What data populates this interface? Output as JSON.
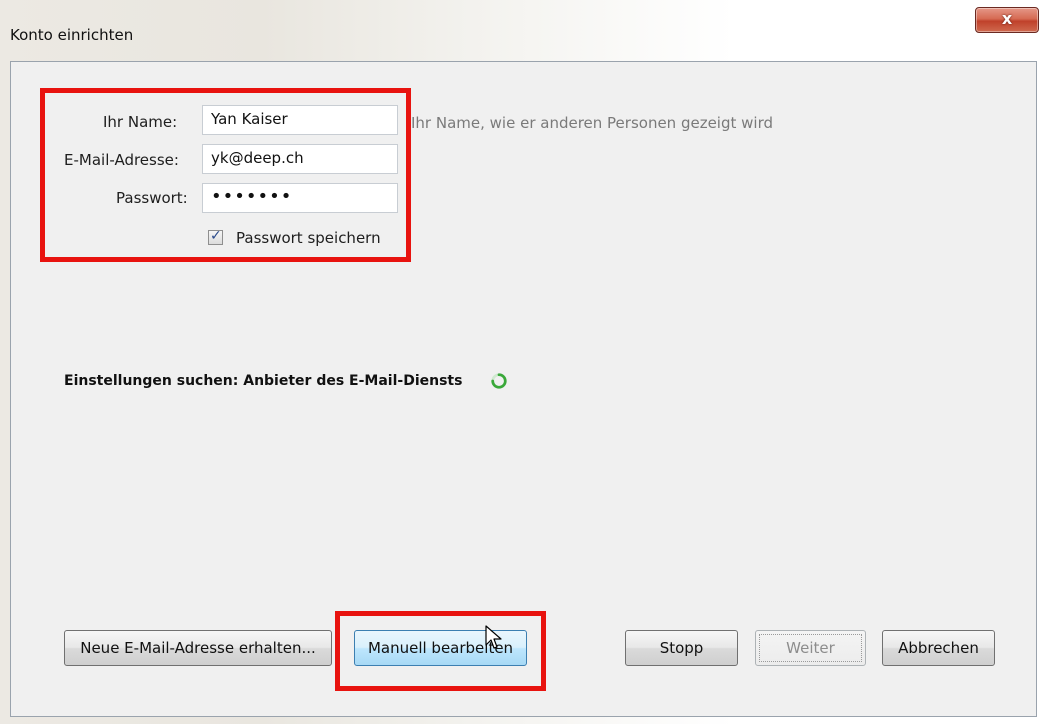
{
  "window": {
    "title": "Konto einrichten",
    "close_label": "x"
  },
  "form": {
    "name_label": "Ihr Name:",
    "name_value": "Yan Kaiser",
    "name_hint": "Ihr Name, wie er anderen Personen gezeigt wird",
    "email_label": "E-Mail-Adresse:",
    "email_value": "yk@deep.ch",
    "password_label": "Passwort:",
    "password_value": "•••••••",
    "remember_label": "Passwort speichern",
    "remember_checked": true
  },
  "status": {
    "text": "Einstellungen suchen: Anbieter des E-Mail-Diensts"
  },
  "buttons": {
    "new_address": "Neue E-Mail-Adresse erhalten...",
    "manual_edit": "Manuell bearbeiten",
    "stop": "Stopp",
    "next": "Weiter",
    "cancel": "Abbrechen"
  },
  "colors": {
    "highlight_box": "#e8130f",
    "spinner": "#3aa83a"
  }
}
